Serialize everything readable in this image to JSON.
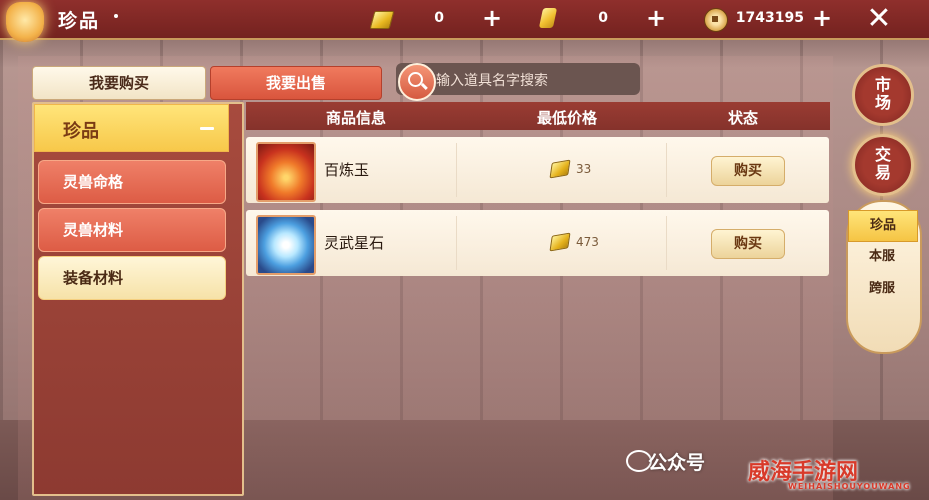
{
  "header": {
    "title": "珍品",
    "currencies": [
      {
        "icon": "ticket-icon",
        "value": "0"
      },
      {
        "icon": "gold-bar-icon",
        "value": "0"
      },
      {
        "icon": "copper-coin-icon",
        "value": "1743195"
      }
    ]
  },
  "tabs": {
    "buy": "我要购买",
    "sell": "我要出售"
  },
  "search": {
    "placeholder": "输入道具名字搜索"
  },
  "sidebar": {
    "active": "珍品",
    "items": [
      {
        "label": "灵兽命格"
      },
      {
        "label": "灵兽材料"
      },
      {
        "label": "装备材料"
      }
    ]
  },
  "table": {
    "headers": [
      "商品信息",
      "最低价格",
      "状态"
    ],
    "rows": [
      {
        "name": "百炼玉",
        "icon": "fire-jade-icon",
        "price": "33",
        "action": "购买"
      },
      {
        "name": "灵武星石",
        "icon": "star-stone-icon",
        "price": "473",
        "action": "购买"
      }
    ]
  },
  "right_nav": {
    "market": [
      "市",
      "场"
    ],
    "trade": [
      "交",
      "易"
    ],
    "subs": [
      "珍品",
      "本服",
      "跨服"
    ]
  },
  "watermarks": {
    "wechat": "公众号",
    "site": "威海手游网",
    "site_sub": "WEIHAISHOUYOUWANG"
  },
  "colors": {
    "header_bg": "#8f2f2c",
    "accent_gold": "#f7c84a",
    "button_red": "#d9553d"
  }
}
